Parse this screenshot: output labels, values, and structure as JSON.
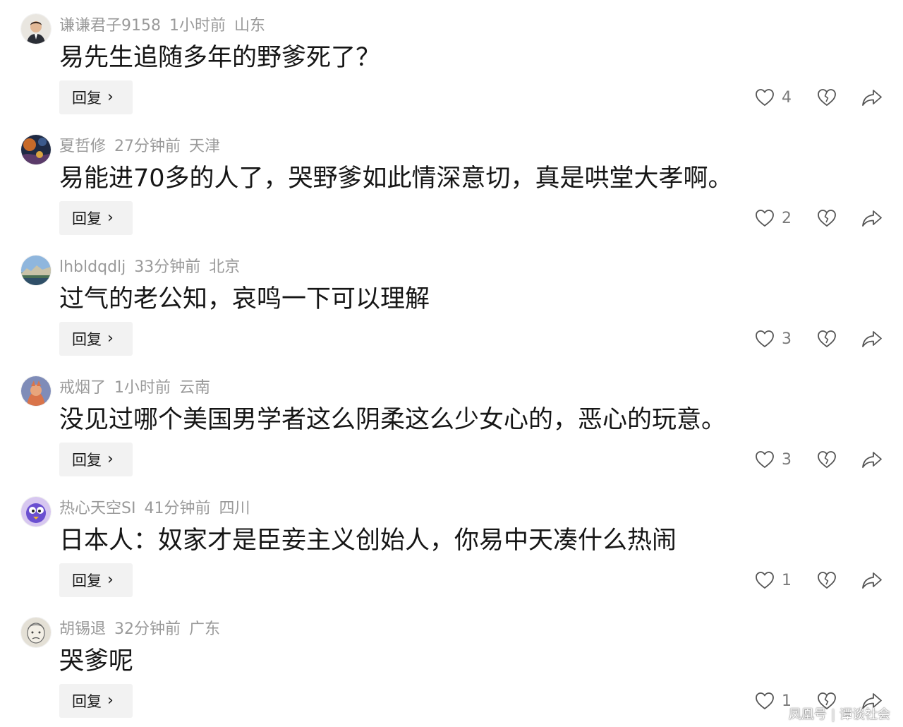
{
  "comments": [
    {
      "user": "谦谦君子9158",
      "time": "1小时前",
      "location": "山东",
      "text": "易先生追随多年的野爹死了？",
      "reply_label": "回复",
      "likes": "4",
      "avatar_icon": "avatar-man-in-suit"
    },
    {
      "user": "夏哲修",
      "time": "27分钟前",
      "location": "天津",
      "text": "易能进70多的人了，哭野爹如此情深意切，真是哄堂大孝啊。",
      "reply_label": "回复",
      "likes": "2",
      "avatar_icon": "avatar-dark-artwork"
    },
    {
      "user": "lhbldqdlj",
      "time": "33分钟前",
      "location": "北京",
      "text": "过气的老公知，哀鸣一下可以理解",
      "reply_label": "回复",
      "likes": "3",
      "avatar_icon": "avatar-landscape"
    },
    {
      "user": "戒烟了",
      "time": "1小时前",
      "location": "云南",
      "text": "没见过哪个美国男学者这么阴柔这么少女心的，恶心的玩意。",
      "reply_label": "回复",
      "likes": "3",
      "avatar_icon": "avatar-cartoon-figure"
    },
    {
      "user": "热心天空SI",
      "time": "41分钟前",
      "location": "四川",
      "text": "日本人：奴家才是臣妾主义创始人，你易中天凑什么热闹",
      "reply_label": "回复",
      "likes": "1",
      "avatar_icon": "avatar-cartoon-bird"
    },
    {
      "user": "胡锡退",
      "time": "32分钟前",
      "location": "广东",
      "text": "哭爹呢",
      "reply_label": "回复",
      "likes": "1",
      "avatar_icon": "avatar-face-sketch"
    }
  ],
  "watermark": {
    "left": "凤凰号",
    "right": "谭谈社会"
  },
  "colors": {
    "meta": "#9a9a9a",
    "text": "#161616",
    "reply_bg": "#f2f2f2",
    "icon": "#555555"
  }
}
